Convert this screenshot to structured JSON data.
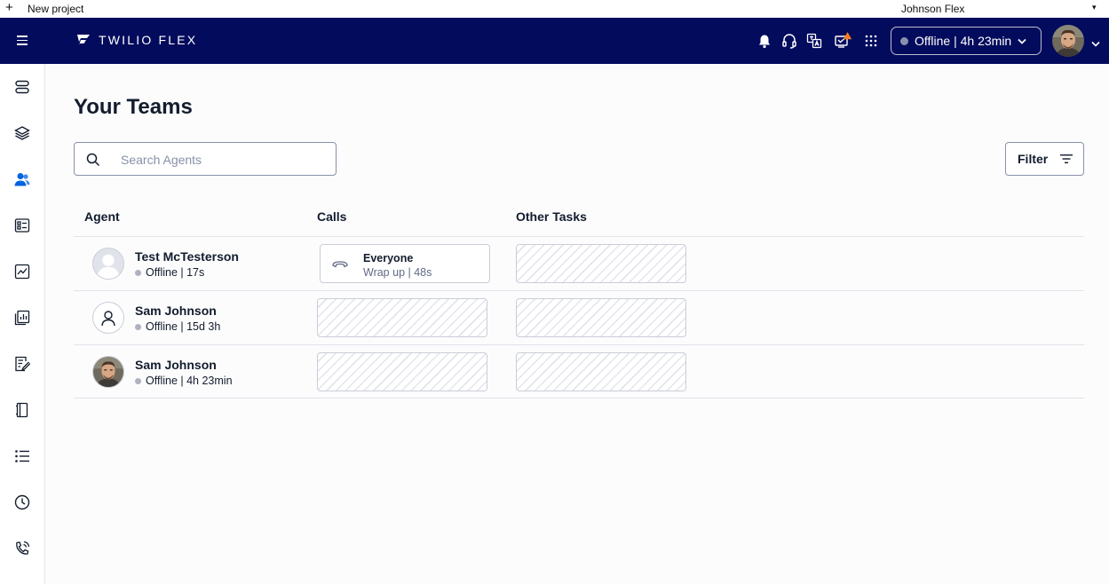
{
  "os_bar": {
    "plus": "+",
    "new_project": "New project",
    "account": "Johnson Flex",
    "caret": "▾"
  },
  "header": {
    "brand": "TWILIO FLEX",
    "status": "Offline | 4h 23min",
    "icons": [
      "menu-icon",
      "bell-icon",
      "headset-icon",
      "translate-icon",
      "notification-alert-icon",
      "apps-grid-icon",
      "chevron-down-icon"
    ]
  },
  "sidebar": {
    "icons": [
      "server-icon",
      "layers-icon",
      "teams-icon",
      "queue-stats-icon",
      "insights-icon",
      "reports-icon",
      "checklist-icon",
      "notebook-icon",
      "list-icon",
      "clock-icon",
      "phone-icon"
    ],
    "active": "teams-icon",
    "active_color": "#0263e0"
  },
  "main": {
    "title": "Your Teams",
    "search_placeholder": "Search Agents",
    "search_value": "",
    "filter_label": "Filter",
    "columns": [
      "Agent",
      "Calls",
      "Other Tasks"
    ]
  },
  "agents": [
    {
      "name": "Test McTesterson",
      "status": "Offline | 17s",
      "avatar": "default-avatar",
      "call": {
        "title": "Everyone",
        "sub": "Wrap up | 48s"
      }
    },
    {
      "name": "Sam Johnson",
      "status": "Offline | 15d 3h",
      "avatar": "user-outline-avatar",
      "call": null
    },
    {
      "name": "Sam Johnson",
      "status": "Offline | 4h 23min",
      "avatar": "photo-avatar",
      "call": null
    }
  ],
  "colors": {
    "header_bg": "#030b5d",
    "offline_dot": "#aeb2c1",
    "alert_dot": "#f47c22"
  }
}
